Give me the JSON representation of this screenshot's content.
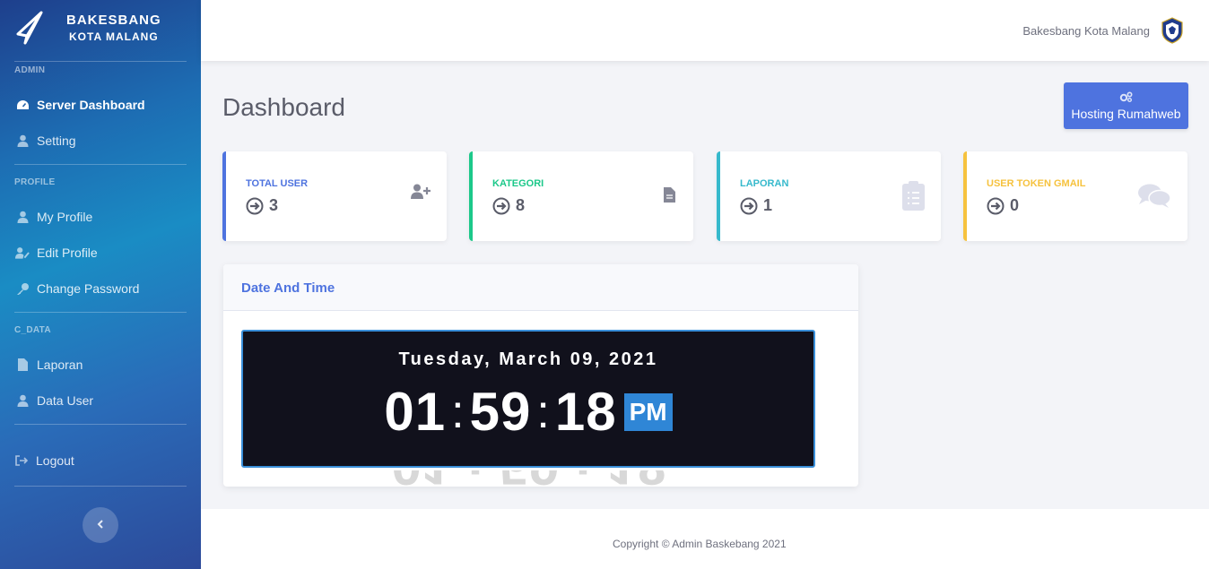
{
  "brand": {
    "line1": "BAKESBANG",
    "line2": "KOTA MALANG"
  },
  "sidebar": {
    "sections": [
      {
        "title": "ADMIN",
        "items": [
          {
            "label": "Server Dashboard",
            "icon": "dashboard-icon",
            "active": true
          },
          {
            "label": "Setting",
            "icon": "user-icon"
          }
        ]
      },
      {
        "title": "PROFILE",
        "items": [
          {
            "label": "My Profile",
            "icon": "user-icon"
          },
          {
            "label": "Edit Profile",
            "icon": "user-edit-icon"
          },
          {
            "label": "Change Password",
            "icon": "key-icon"
          }
        ]
      },
      {
        "title": "C_DATA",
        "items": [
          {
            "label": "Laporan",
            "icon": "file-icon"
          },
          {
            "label": "Data User",
            "icon": "user-icon"
          }
        ]
      }
    ],
    "logout": "Logout"
  },
  "topbar": {
    "username": "Bakesbang Kota Malang"
  },
  "page": {
    "title": "Dashboard"
  },
  "hosting_button": "Hosting Rumahweb",
  "cards": [
    {
      "label": "TOTAL USER",
      "value": "3",
      "color": "#4e73df",
      "icon": "user-plus-icon"
    },
    {
      "label": "KATEGORI",
      "value": "8",
      "color": "#1cc88a",
      "icon": "file-icon"
    },
    {
      "label": "LAPORAN",
      "value": "1",
      "color": "#36b9cc",
      "icon": "clipboard-list-icon"
    },
    {
      "label": "USER TOKEN GMAIL",
      "value": "0",
      "color": "#f6c23e",
      "icon": "comments-icon"
    }
  ],
  "panel": {
    "title": "Date And Time",
    "date": "Tuesday, March 09, 2021",
    "hours": "01",
    "minutes": "59",
    "seconds": "18",
    "ampm": "PM"
  },
  "footer": {
    "copyright": "Copyright © Admin Baskebang 2021"
  }
}
